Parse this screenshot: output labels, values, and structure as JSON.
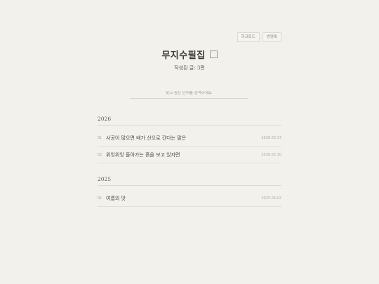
{
  "header": {
    "buttons": [
      "하크토드",
      "방명록"
    ],
    "title": "무지수필집",
    "subtitle": "작성된 글: 3편"
  },
  "search": {
    "placeholder": "찾고 싶은 단어를 검색하세요"
  },
  "years": [
    {
      "year": "2026",
      "posts": [
        {
          "num": "01",
          "title": "사공이 많으면 배가 산으로 간다는 말은",
          "date": "2026.03.17"
        },
        {
          "num": "02",
          "title": "위잉위잉 돌아가는 흙을 보고 있자면",
          "date": "2026.02.10"
        }
      ]
    },
    {
      "year": "2025",
      "posts": [
        {
          "num": "01",
          "title": "여름의 맛",
          "date": "2025.06.02"
        }
      ]
    }
  ]
}
